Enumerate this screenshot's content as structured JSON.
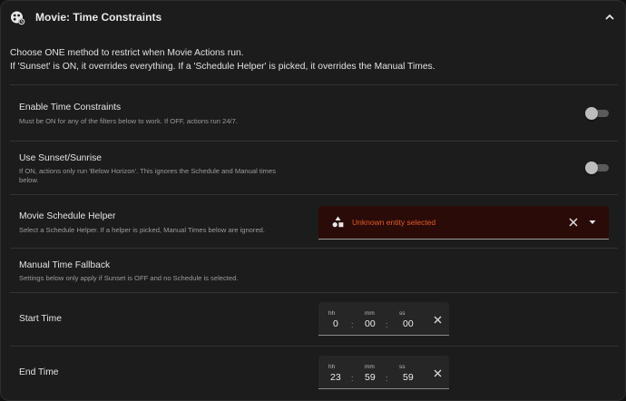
{
  "header": {
    "title": "Movie: Time Constraints",
    "icon": "movie-clock-icon",
    "collapse_icon": "chevron-up-icon"
  },
  "intro": {
    "line1": "Choose ONE method to restrict when Movie Actions run.",
    "line2": "If 'Sunset' is ON, it overrides everything. If a 'Schedule Helper' is picked, it overrides the Manual Times."
  },
  "rows": {
    "enable": {
      "title": "Enable Time Constraints",
      "desc": "Must be ON for any of the filters below to work. If OFF, actions run 24/7.",
      "toggle_on": false
    },
    "sunset": {
      "title": "Use Sunset/Sunrise",
      "desc_line1": "If ON, actions only run 'Below Horizon'. This ignores the Schedule and Manual times",
      "desc_line2": "below.",
      "toggle_on": false
    },
    "schedule": {
      "title": "Movie Schedule Helper",
      "desc": "Select a Schedule Helper. If a helper is picked, Manual Times below are ignored.",
      "entity_text": "Unknown entity selected",
      "entity_icon": "shapes-icon"
    },
    "fallback": {
      "title": "Manual Time Fallback",
      "desc": "Settings below only apply if Sunset is OFF and no Schedule is selected."
    },
    "start": {
      "title": "Start Time",
      "hh_label": "hh",
      "mm_label": "mm",
      "ss_label": "ss",
      "hh": "0",
      "mm": "00",
      "ss": "00"
    },
    "end": {
      "title": "End Time",
      "hh_label": "hh",
      "mm_label": "mm",
      "ss_label": "ss",
      "hh": "23",
      "mm": "59",
      "ss": "59"
    }
  },
  "colors": {
    "card_bg": "#1c1c1c",
    "error_bg": "#2b0b07",
    "error_text": "#e65a2a",
    "divider": "#333333"
  }
}
